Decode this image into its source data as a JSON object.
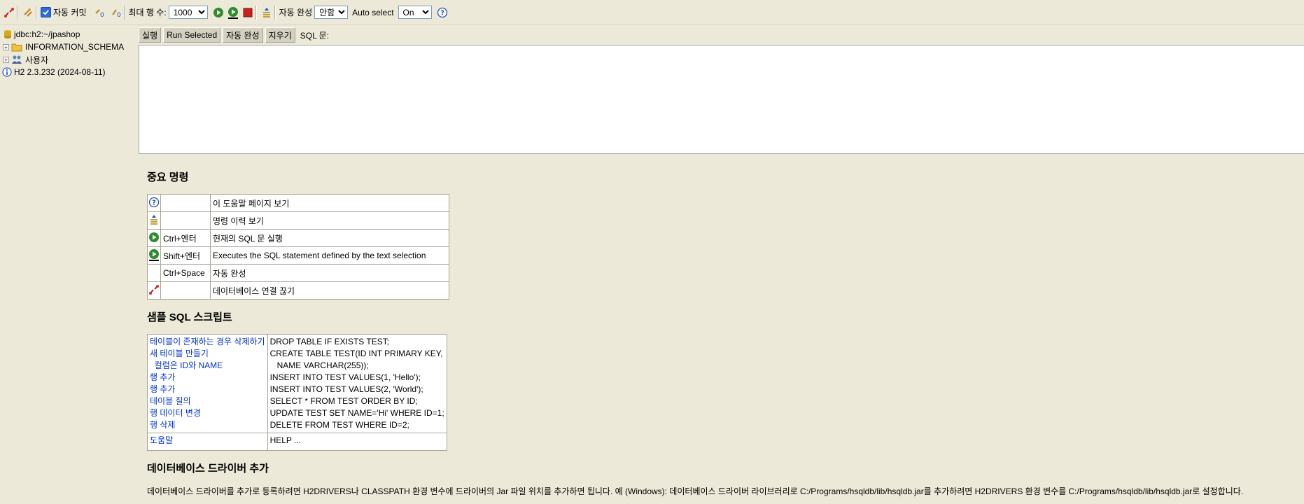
{
  "toolbar": {
    "auto_commit_label": "자동 커밋",
    "max_rows_label": "최대 행 수:",
    "max_rows_value": "1000",
    "autocomplete_label": "자동 완성",
    "autocomplete_value": "안함",
    "auto_select_label": "Auto select",
    "auto_select_value": "On"
  },
  "tree": {
    "connection": "jdbc:h2:~/jpashop",
    "schema": "INFORMATION_SCHEMA",
    "users": "사용자",
    "version": "H2 2.3.232 (2024-08-11)"
  },
  "sql_bar": {
    "run": "실행",
    "run_selected": "Run Selected",
    "autocomplete": "자동 완성",
    "clear": "지우기",
    "sql_label": "SQL 문:"
  },
  "help": {
    "title": "중요 명령",
    "rows": [
      {
        "icon": "help-icon",
        "key": "",
        "desc": "이 도움말 페이지 보기"
      },
      {
        "icon": "history-icon",
        "key": "",
        "desc": "명령 이력 보기"
      },
      {
        "icon": "run-icon",
        "key": "Ctrl+엔터",
        "desc": "현재의 SQL 문 실행"
      },
      {
        "icon": "run-selected-icon",
        "key": "Shift+엔터",
        "desc": "Executes the SQL statement defined by the text selection"
      },
      {
        "icon": "",
        "key": "Ctrl+Space",
        "desc": "자동 완성"
      },
      {
        "icon": "disconnect-icon",
        "key": "",
        "desc": "데이터베이스 연결 끊기"
      }
    ]
  },
  "samples": {
    "title": "샘플 SQL 스크립트",
    "links": [
      "테이블이 존재하는 경우 삭제하기",
      "새 테이블 만들기",
      "  컬럼은 ID와 NAME",
      "행 추가",
      "행 추가",
      "테이블 질의",
      "행 데이터 변경",
      "행 삭제"
    ],
    "sql": [
      "DROP TABLE IF EXISTS TEST;",
      "CREATE TABLE TEST(ID INT PRIMARY KEY,",
      "   NAME VARCHAR(255));",
      "INSERT INTO TEST VALUES(1, 'Hello');",
      "INSERT INTO TEST VALUES(2, 'World');",
      "SELECT * FROM TEST ORDER BY ID;",
      "UPDATE TEST SET NAME='Hi' WHERE ID=1;",
      "DELETE FROM TEST WHERE ID=2;"
    ],
    "help_link": "도움말",
    "help_sql": "HELP ..."
  },
  "drivers": {
    "title": "데이터베이스 드라이버 추가",
    "text": "데이터베이스 드라이버를 추가로 등록하려면 H2DRIVERS나 CLASSPATH 환경 변수에 드라이버의 Jar 파일 위치를 추가하면 됩니다. 예 (Windows): 데이터베이스 드라이버 라이브러리로 C:/Programs/hsqldb/lib/hsqldb.jar를 추가하려면 H2DRIVERS 환경 변수를 C:/Programs/hsqldb/lib/hsqldb.jar로 설정합니다."
  }
}
